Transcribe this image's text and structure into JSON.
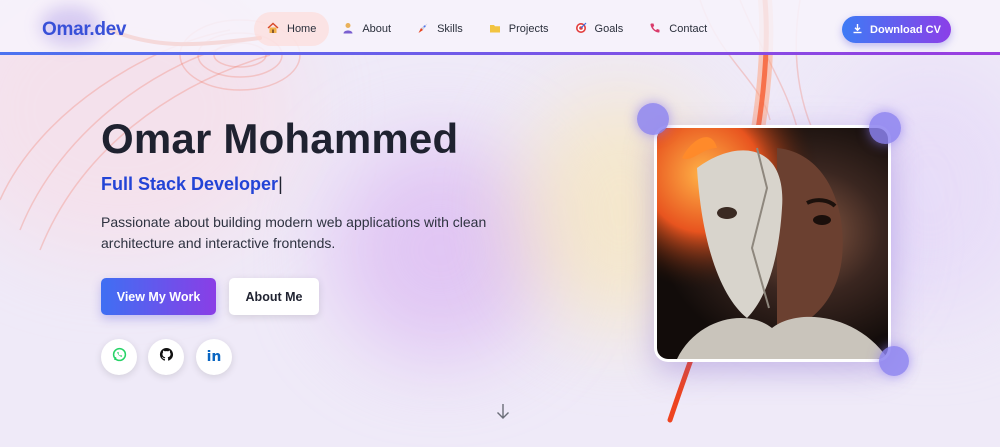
{
  "header": {
    "logo": "Omar.dev",
    "nav": [
      {
        "label": "Home",
        "icon": "house-icon",
        "active": true
      },
      {
        "label": "About",
        "icon": "person-icon"
      },
      {
        "label": "Skills",
        "icon": "rocket-icon"
      },
      {
        "label": "Projects",
        "icon": "folder-icon"
      },
      {
        "label": "Goals",
        "icon": "target-icon"
      },
      {
        "label": "Contact",
        "icon": "phone-icon"
      }
    ],
    "download_label": "Download CV"
  },
  "hero": {
    "name": "Omar Mohammed",
    "role": "Full Stack Developer",
    "cursor": "|",
    "description": "Passionate about building modern web applications with clean architecture and interactive frontends.",
    "primary_button": "View My Work",
    "secondary_button": "About Me",
    "social": [
      {
        "name": "whatsapp",
        "icon": "whatsapp-icon",
        "color": "#25d366"
      },
      {
        "name": "github",
        "icon": "github-icon",
        "color": "#111111"
      },
      {
        "name": "linkedin",
        "icon": "linkedin-icon",
        "color": "#0a66c2",
        "glyph": "in"
      }
    ]
  },
  "colors": {
    "accent_blue": "#3850d8",
    "accent_purple": "#8a3ee6",
    "role_text": "#2344d6"
  }
}
